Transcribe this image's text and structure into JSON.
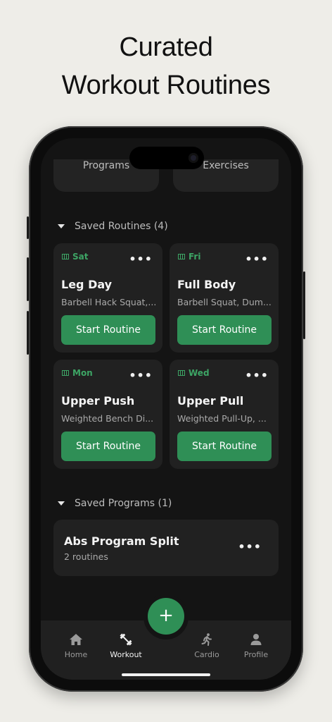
{
  "headline": {
    "line1": "Curated",
    "line2": "Workout Routines"
  },
  "top_cards": {
    "left": "Programs",
    "right": "Exercises"
  },
  "saved_routines": {
    "header": "Saved Routines (4)",
    "items": [
      {
        "day": "Sat",
        "name": "Leg Day",
        "exercises": "Barbell Hack Squat,...",
        "button": "Start Routine"
      },
      {
        "day": "Fri",
        "name": "Full Body",
        "exercises": "Barbell Squat, Dum...",
        "button": "Start Routine"
      },
      {
        "day": "Mon",
        "name": "Upper Push",
        "exercises": "Weighted Bench Di...",
        "button": "Start Routine"
      },
      {
        "day": "Wed",
        "name": "Upper Pull",
        "exercises": "Weighted Pull-Up, ...",
        "button": "Start Routine"
      }
    ]
  },
  "saved_programs": {
    "header": "Saved Programs (1)",
    "items": [
      {
        "name": "Abs Program Split",
        "subtitle": "2 routines"
      }
    ]
  },
  "more_glyph": "•••",
  "fab_label": "+",
  "tabs": {
    "home": "Home",
    "workout": "Workout",
    "cardio": "Cardio",
    "profile": "Profile"
  },
  "colors": {
    "accent": "#2f8f56",
    "day_label": "#3da565",
    "card": "#212121",
    "screen": "#141414"
  },
  "icons": [
    "calendar-icon",
    "more-icon",
    "home-icon",
    "dumbbell-icon",
    "running-icon",
    "person-icon",
    "plus-icon",
    "caret-down-icon"
  ]
}
